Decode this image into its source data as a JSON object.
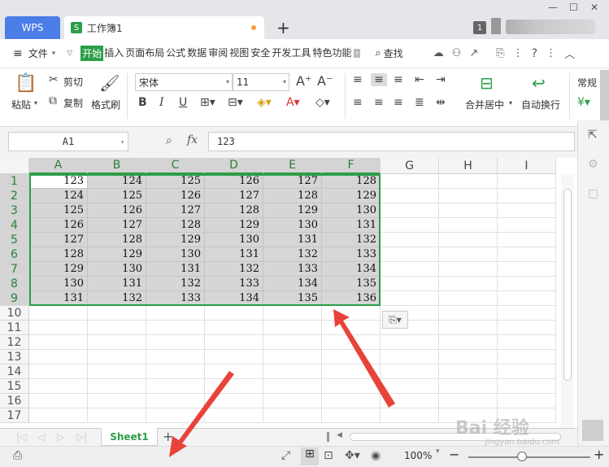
{
  "titlebar": {
    "wps_label": "WPS",
    "doc_title": "工作簿1",
    "doc_icon": "S",
    "new_tab": "+",
    "badge": "1"
  },
  "menu": {
    "file": "文件",
    "items": [
      "开始",
      "插入",
      "页面布局",
      "公式",
      "数据",
      "审阅",
      "视图",
      "安全",
      "开发工具",
      "特色功能"
    ],
    "search": "查找"
  },
  "ribbon": {
    "paste": "粘贴",
    "cut": "剪切",
    "copy": "复制",
    "format_painter": "格式刷",
    "font_name": "宋体",
    "font_size": "11",
    "merge_center": "合并居中",
    "wrap_text": "自动换行",
    "number_format": "常规"
  },
  "formula_bar": {
    "cell_ref": "A1",
    "fx": "fx",
    "value": "123"
  },
  "sheet": {
    "columns": [
      "A",
      "B",
      "C",
      "D",
      "E",
      "F",
      "G",
      "H",
      "I"
    ],
    "rows": [
      "1",
      "2",
      "3",
      "4",
      "5",
      "6",
      "7",
      "8",
      "9",
      "10",
      "11",
      "12",
      "13",
      "14",
      "15",
      "16",
      "17"
    ],
    "values": [
      [
        123,
        124,
        125,
        126,
        127,
        128
      ],
      [
        124,
        125,
        126,
        127,
        128,
        129
      ],
      [
        125,
        126,
        127,
        128,
        129,
        130
      ],
      [
        126,
        127,
        128,
        129,
        130,
        131
      ],
      [
        127,
        128,
        129,
        130,
        131,
        132
      ],
      [
        128,
        129,
        130,
        131,
        132,
        133
      ],
      [
        129,
        130,
        131,
        132,
        133,
        134
      ],
      [
        130,
        131,
        132,
        133,
        134,
        135
      ],
      [
        131,
        132,
        133,
        134,
        135,
        136
      ]
    ]
  },
  "sheet_tabs": {
    "active": "Sheet1",
    "add": "+"
  },
  "status": {
    "zoom": "100%"
  },
  "watermark": {
    "main": "Bai 经验",
    "sub": "jingyan.baidu.com"
  },
  "colors": {
    "accent": "#2c9e48",
    "wps_blue": "#4a7de8",
    "arrow": "#e8433a"
  }
}
